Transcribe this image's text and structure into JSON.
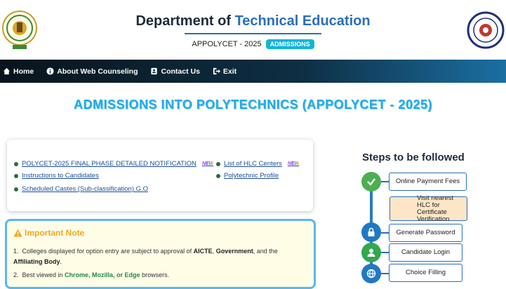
{
  "header": {
    "title_part1": "Department of ",
    "title_part2": "Technical Education",
    "subtitle": "APPOLYCET - 2025",
    "badge": "ADMISSIONS",
    "left_logo_icon": "ap-govt-emblem-icon",
    "right_logo_icon": "dte-seal-icon"
  },
  "nav": {
    "items": [
      {
        "label": "Home",
        "icon": "home-icon"
      },
      {
        "label": "About Web Counseling",
        "icon": "info-icon"
      },
      {
        "label": "Contact Us",
        "icon": "contact-card-icon"
      },
      {
        "label": "Exit",
        "icon": "exit-icon"
      }
    ]
  },
  "main_heading": "ADMISSIONS INTO POLYTECHNICS (APPOLYCET - 2025)",
  "links": {
    "left": [
      {
        "label": "POLYCET-2025 FINAL PHASE DETAILED NOTIFICATION",
        "new": "NEW"
      },
      {
        "label": "Instructions to Candidates"
      },
      {
        "label": "Scheduled Castes (Sub-classification) G.O"
      }
    ],
    "right": [
      {
        "label": "List of HLC Centers",
        "new": "NEW"
      },
      {
        "label": "Polytechnic Profile"
      }
    ]
  },
  "note": {
    "title": "Important Note",
    "item1_a": "Colleges displayed for option entry are subject to approval of ",
    "item1_b": "AICTE",
    "item1_c": ", ",
    "item1_d": "Government",
    "item1_e": ", and the ",
    "item1_f": "Affiliating Body",
    "item1_g": ".",
    "item2_a": "Best viewed in ",
    "item2_b": "Chrome, Mozilla, or Edge",
    "item2_c": " browsers."
  },
  "steps": {
    "title": "Steps to be followed",
    "items": [
      {
        "label": "Online Payment Fees",
        "icon": "check-icon",
        "color": "#4caf50"
      },
      {
        "label": "Visit nearest HLC for Certificate Verification",
        "icon": "bank-icon",
        "color": "#f59e2b"
      },
      {
        "label": "Generate Password",
        "icon": "lock-icon",
        "color": "#1f79c2"
      },
      {
        "label": "Candidate Login",
        "icon": "user-icon",
        "color": "#2fa84f"
      },
      {
        "label": "Choice Filling",
        "icon": "globe-icon",
        "color": "#1f79c2"
      }
    ]
  }
}
